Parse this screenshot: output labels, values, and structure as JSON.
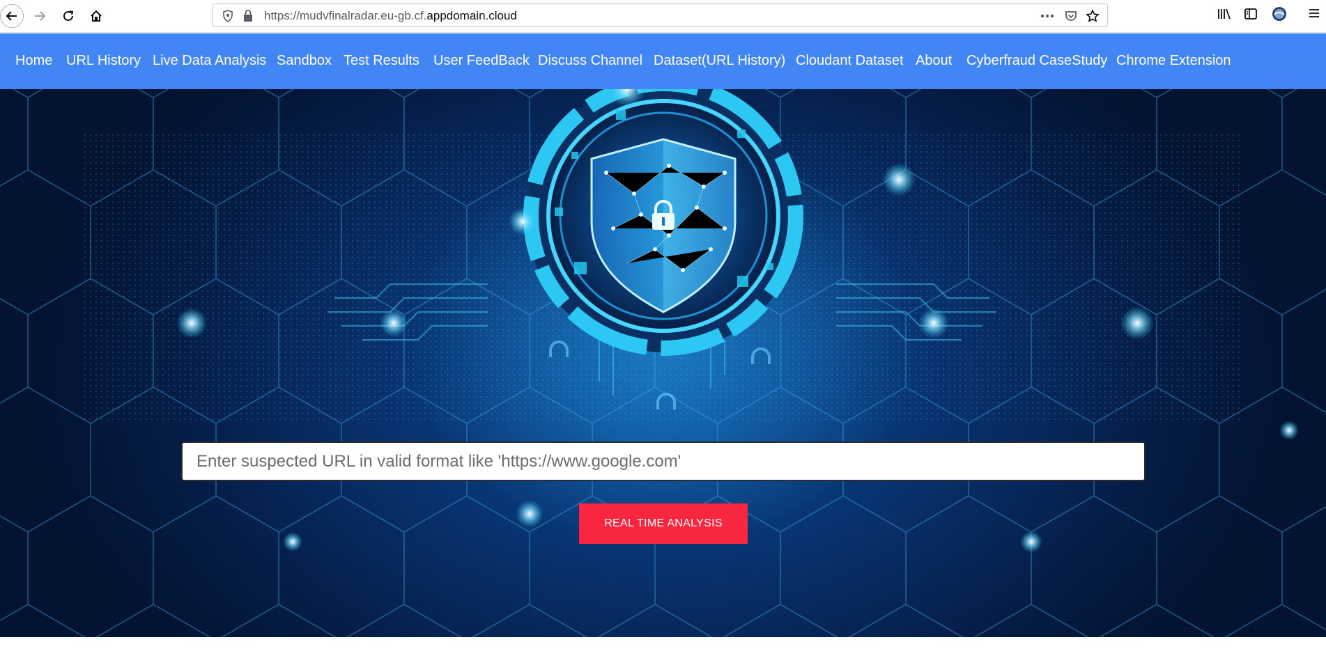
{
  "browser": {
    "url_prefix": "https://mudvfinalradar.eu-gb.cf.",
    "url_domain": "appdomain.cloud",
    "icons": [
      "back-arrow-icon",
      "forward-arrow-icon",
      "reload-icon",
      "home-icon",
      "shield-icon",
      "lock-icon",
      "more-icon",
      "pocket-icon",
      "star-icon",
      "library-icon",
      "sidebar-icon",
      "profile-icon",
      "menu-icon"
    ]
  },
  "nav": {
    "items": [
      {
        "label": "Home"
      },
      {
        "label": "URL History"
      },
      {
        "label": "Live Data Analysis"
      },
      {
        "label": "Sandbox"
      },
      {
        "label": "Test Results"
      },
      {
        "label": "User FeedBack"
      },
      {
        "label": "Discuss Channel"
      },
      {
        "label": "Dataset(URL History)"
      },
      {
        "label": "Cloudant Dataset"
      },
      {
        "label": "About"
      },
      {
        "label": "Cyberfraud CaseStudy"
      },
      {
        "label": "Chrome Extension"
      }
    ]
  },
  "hero": {
    "input_placeholder": "Enter suspected URL in valid format like 'https://www.google.com'",
    "button_label": "REAL TIME ANALYSIS"
  },
  "colors": {
    "nav_bg": "#4285f4",
    "button_bg": "#f8263f",
    "hero_dark": "#051c44",
    "hero_glow": "#21c8f0"
  }
}
